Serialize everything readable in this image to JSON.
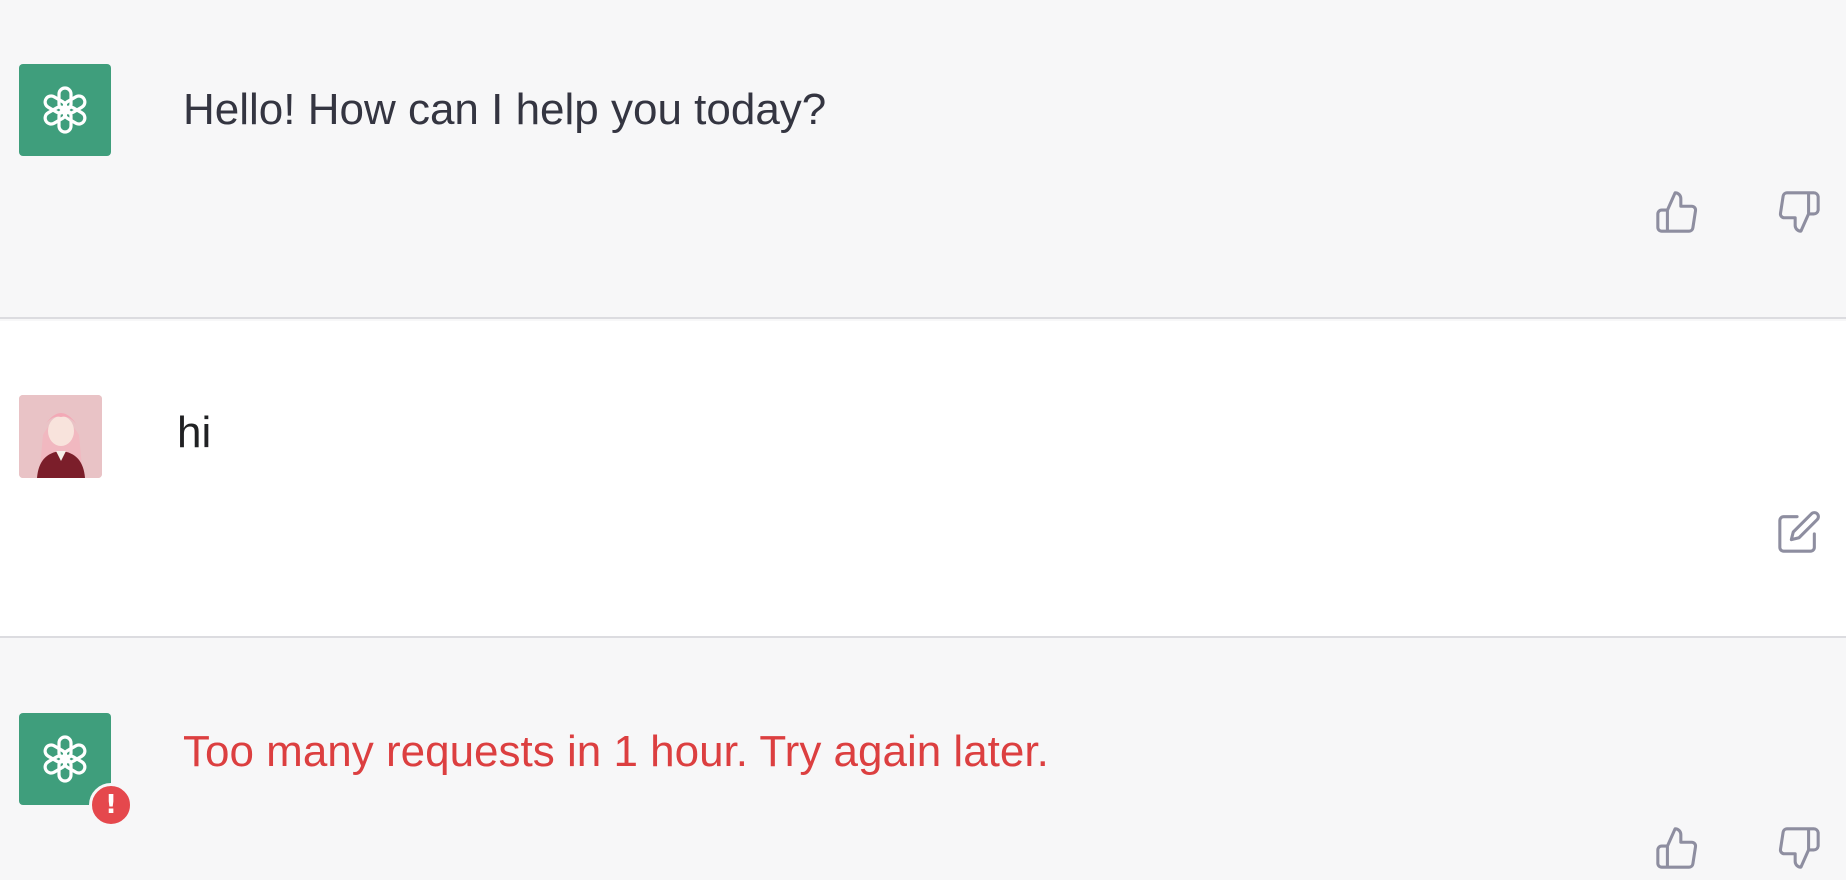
{
  "conversation": {
    "messages": [
      {
        "role": "assistant",
        "avatar_icon": "openai-logo-icon",
        "text": "Hello! How can I help you today?",
        "actions": [
          "thumbs-up-icon",
          "thumbs-down-icon"
        ]
      },
      {
        "role": "user",
        "avatar_icon": "user-avatar",
        "text": "hi",
        "actions": [
          "edit-icon"
        ]
      },
      {
        "role": "assistant",
        "avatar_icon": "openai-logo-icon",
        "status_icon": "error-icon",
        "error_badge": "!",
        "text": "Too many requests in 1 hour. Try again later.",
        "actions": [
          "thumbs-up-icon",
          "thumbs-down-icon"
        ]
      }
    ]
  },
  "colors": {
    "assistant_bg": "#f7f7f8",
    "user_bg": "#ffffff",
    "bot_avatar": "#3f9e7c",
    "error_text": "#dc3f40",
    "error_badge": "#e5484d",
    "icon_stroke": "#8e8ea0"
  }
}
